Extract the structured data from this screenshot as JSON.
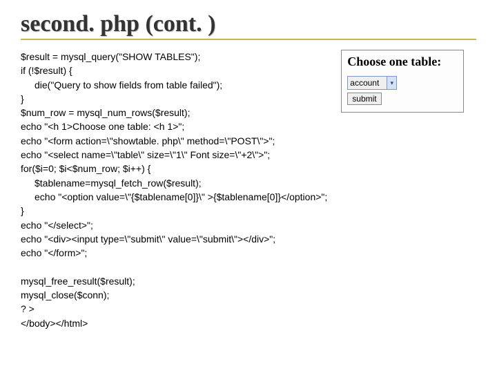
{
  "title": "second. php (cont. )",
  "code": {
    "l1": "$result = mysql_query(\"SHOW TABLES\");",
    "l2": "if (!$result) {",
    "l3": "die(\"Query to show fields from table failed\");",
    "l4": "}",
    "l5": "$num_row = mysql_num_rows($result);",
    "l6": "echo \"<h 1>Choose one table: <h 1>\";",
    "l7": "echo \"<form action=\\\"showtable. php\\\" method=\\\"POST\\\">\";",
    "l8": "echo \"<select name=\\\"table\\\" size=\\\"1\\\" Font size=\\\"+2\\\">\";",
    "l9": "for($i=0; $i<$num_row; $i++) {",
    "l10": "$tablename=mysql_fetch_row($result);",
    "l11": "echo \"<option value=\\\"{$tablename[0]}\\\" >{$tablename[0]}</option>\";",
    "l12": "}",
    "l13": "echo \"</select>\";",
    "l14": "echo \"<div><input type=\\\"submit\\\" value=\\\"submit\\\"></div>\";",
    "l15": "echo \"</form>\";",
    "l16": "",
    "l17": "mysql_free_result($result);",
    "l18": "mysql_close($conn);",
    "l19": "? >",
    "l20": "</body></html>"
  },
  "preview": {
    "heading": "Choose one table:",
    "select_value": "account",
    "dropdown_icon": "▾",
    "submit_label": "submit"
  }
}
